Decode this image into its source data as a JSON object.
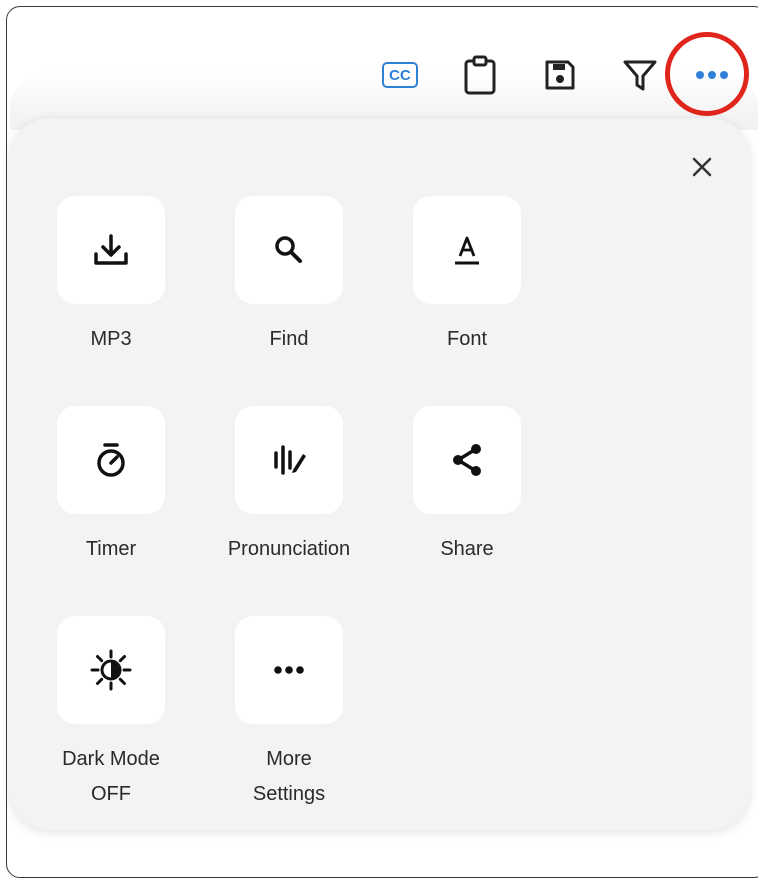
{
  "toolbar": {
    "captions_label": "CC",
    "icons": [
      "captions-icon",
      "clipboard-icon",
      "save-icon",
      "filter-icon",
      "more-icon"
    ],
    "accent_color": "#2f80d8",
    "highlight_color": "#e0261c"
  },
  "menu": {
    "items": [
      {
        "label": "MP3",
        "icon": "download-icon"
      },
      {
        "label": "Find",
        "icon": "search-icon"
      },
      {
        "label": "Font",
        "icon": "font-icon"
      },
      {
        "label": "Timer",
        "icon": "timer-icon"
      },
      {
        "label": "Pronunciation",
        "icon": "pronunciation-icon"
      },
      {
        "label": "Share",
        "icon": "share-icon"
      },
      {
        "label": "Dark Mode\nOFF",
        "icon": "dark-mode-icon",
        "line1": "Dark Mode",
        "line2": "OFF"
      },
      {
        "label": "More\nSettings",
        "icon": "more-icon",
        "line1": "More",
        "line2": "Settings"
      }
    ]
  }
}
